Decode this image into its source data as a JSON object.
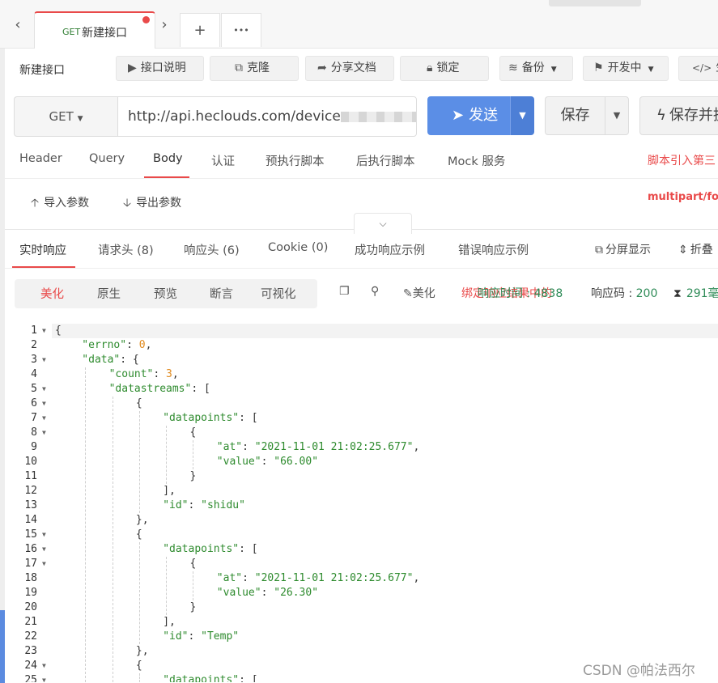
{
  "tabs": {
    "active": {
      "method": "GET",
      "title": "新建接口"
    },
    "add_label": "+",
    "more_label": "•••"
  },
  "toolbar": {
    "title": "新建接口",
    "buttons": [
      {
        "icon": "play-icon",
        "label": "接口说明"
      },
      {
        "icon": "copy-icon",
        "label": "克隆"
      },
      {
        "icon": "share-icon",
        "label": "分享文档"
      },
      {
        "icon": "lock-icon",
        "label": "锁定"
      },
      {
        "icon": "database-icon",
        "label": "备份"
      },
      {
        "icon": "flag-icon",
        "label": "开发中"
      },
      {
        "icon": "code-icon",
        "label": "生"
      }
    ]
  },
  "request": {
    "method": "GET",
    "url": "http://api.heclouds.com/device",
    "send_label": "发送",
    "save_label": "保存",
    "save_run_label": "保存并执"
  },
  "request_tabs": [
    "Header",
    "Query",
    "Body",
    "认证",
    "预执行脚本",
    "后执行脚本",
    "Mock 服务"
  ],
  "request_tabs_active": "Body",
  "script_note": "脚本引入第三",
  "params": {
    "import_label": "导入参数",
    "export_label": "导出参数",
    "content_type": "multipart/for"
  },
  "response_tabs": [
    "实时响应",
    "请求头 (8)",
    "响应头 (6)",
    "Cookie (0)",
    "成功响应示例",
    "错误响应示例"
  ],
  "response_tabs_active": "实时响应",
  "response_actions": {
    "split_label": "分屏显示",
    "fold_label": "折叠"
  },
  "view_modes": [
    "美化",
    "原生",
    "预览",
    "断言",
    "可视化"
  ],
  "view_mode_active": "美化",
  "response_toolbar": {
    "beautify_label": "美化",
    "overlap_red": "绑定响应结果中的",
    "overlap_green": "响应时间 : 4838",
    "status_label": "响应码 : ",
    "status_code": "200",
    "time_text": "291毫"
  },
  "code_lines": [
    {
      "n": "1",
      "fold": true,
      "indent": 0,
      "html": "{"
    },
    {
      "n": "2",
      "fold": false,
      "indent": 1,
      "html": "<span class='k'>\"errno\"</span>: <span class='n'>0</span>,"
    },
    {
      "n": "3",
      "fold": true,
      "indent": 1,
      "html": "<span class='k'>\"data\"</span>: {"
    },
    {
      "n": "4",
      "fold": false,
      "indent": 2,
      "html": "<span class='k'>\"count\"</span>: <span class='n'>3</span>,"
    },
    {
      "n": "5",
      "fold": true,
      "indent": 2,
      "html": "<span class='k'>\"datastreams\"</span>: ["
    },
    {
      "n": "6",
      "fold": true,
      "indent": 3,
      "html": "{"
    },
    {
      "n": "7",
      "fold": true,
      "indent": 4,
      "html": "<span class='k'>\"datapoints\"</span>: ["
    },
    {
      "n": "8",
      "fold": true,
      "indent": 5,
      "html": "{"
    },
    {
      "n": "9",
      "fold": false,
      "indent": 6,
      "html": "<span class='k'>\"at\"</span>: <span class='s'>\"2021-11-01 21:02:25.677\"</span>,"
    },
    {
      "n": "10",
      "fold": false,
      "indent": 6,
      "html": "<span class='k'>\"value\"</span>: <span class='s'>\"66.00\"</span>"
    },
    {
      "n": "11",
      "fold": false,
      "indent": 5,
      "html": "}"
    },
    {
      "n": "12",
      "fold": false,
      "indent": 4,
      "html": "],"
    },
    {
      "n": "13",
      "fold": false,
      "indent": 4,
      "html": "<span class='k'>\"id\"</span>: <span class='s'>\"shidu\"</span>"
    },
    {
      "n": "14",
      "fold": false,
      "indent": 3,
      "html": "},"
    },
    {
      "n": "15",
      "fold": true,
      "indent": 3,
      "html": "{"
    },
    {
      "n": "16",
      "fold": true,
      "indent": 4,
      "html": "<span class='k'>\"datapoints\"</span>: ["
    },
    {
      "n": "17",
      "fold": true,
      "indent": 5,
      "html": "{"
    },
    {
      "n": "18",
      "fold": false,
      "indent": 6,
      "html": "<span class='k'>\"at\"</span>: <span class='s'>\"2021-11-01 21:02:25.677\"</span>,"
    },
    {
      "n": "19",
      "fold": false,
      "indent": 6,
      "html": "<span class='k'>\"value\"</span>: <span class='s'>\"26.30\"</span>"
    },
    {
      "n": "20",
      "fold": false,
      "indent": 5,
      "html": "}"
    },
    {
      "n": "21",
      "fold": false,
      "indent": 4,
      "html": "],"
    },
    {
      "n": "22",
      "fold": false,
      "indent": 4,
      "html": "<span class='k'>\"id\"</span>: <span class='s'>\"Temp\"</span>"
    },
    {
      "n": "23",
      "fold": false,
      "indent": 3,
      "html": "},"
    },
    {
      "n": "24",
      "fold": true,
      "indent": 3,
      "html": "{"
    },
    {
      "n": "25",
      "fold": true,
      "indent": 4,
      "html": "<span class='k'>\"datapoints\"</span>: ["
    }
  ],
  "watermark": "CSDN @帕法西尔",
  "colors": {
    "accent": "#e94a4a",
    "send_blue": "#5b8ee6",
    "json_green": "#2e8b2e",
    "json_number": "#e08a1e"
  }
}
